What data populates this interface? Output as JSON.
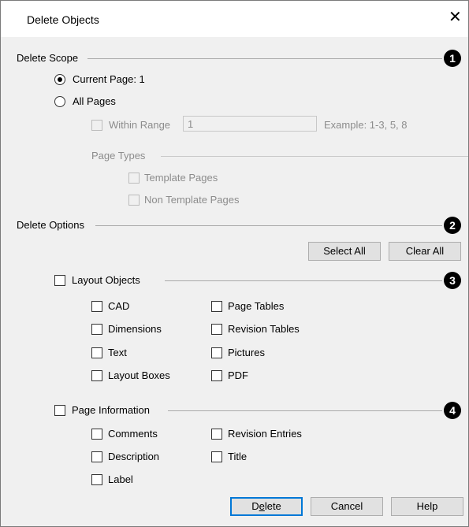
{
  "dialog": {
    "title": "Delete Objects"
  },
  "scope": {
    "heading": "Delete Scope",
    "current_page_label": "Current Page: 1",
    "current_page_selected": true,
    "all_pages_label": "All Pages",
    "within_range_label": "Within Range",
    "range_value": "1",
    "example_text": "Example: 1-3, 5, 8",
    "page_types_heading": "Page Types",
    "template_pages_label": "Template Pages",
    "non_template_pages_label": "Non Template Pages"
  },
  "options": {
    "heading": "Delete Options",
    "select_all_label": "Select All",
    "clear_all_label": "Clear All"
  },
  "layout_objects": {
    "label": "Layout Objects",
    "items": [
      "CAD",
      "Dimensions",
      "Text",
      "Layout Boxes",
      "Page Tables",
      "Revision Tables",
      "Pictures",
      "PDF"
    ]
  },
  "page_information": {
    "label": "Page Information",
    "items": [
      "Comments",
      "Description",
      "Label",
      "Revision Entries",
      "Title"
    ]
  },
  "badges": [
    "1",
    "2",
    "3",
    "4"
  ],
  "footer": {
    "delete_prefix": "D",
    "delete_underlined": "e",
    "delete_suffix": "lete",
    "cancel_label": "Cancel",
    "help_label": "Help"
  },
  "colors": {
    "accent": "#0078d7",
    "dialog_bg": "#f0f0f0",
    "disabled_text": "#8c8c8c"
  }
}
